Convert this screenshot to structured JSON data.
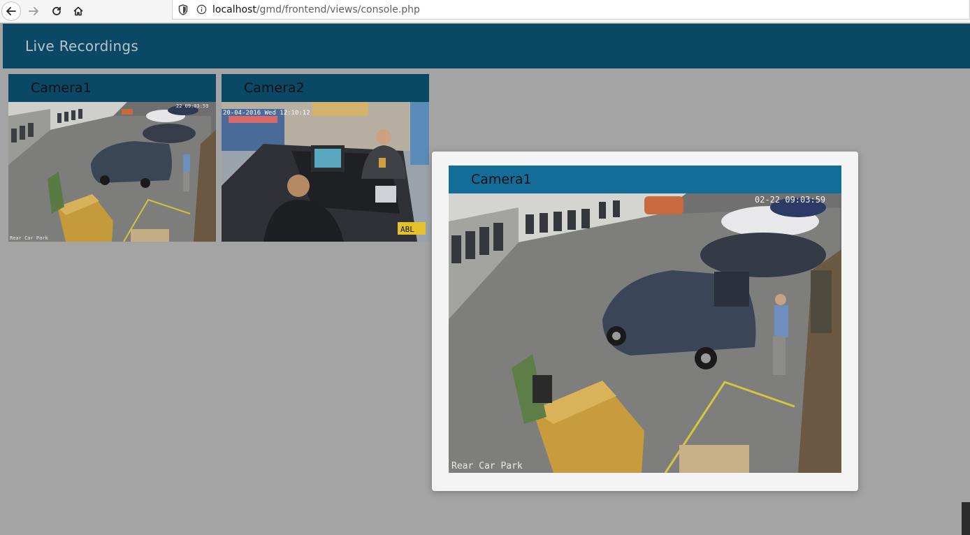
{
  "browser": {
    "url_host": "localhost",
    "url_path": "/gmd/frontend/views/console.php"
  },
  "header": {
    "title": "Live Recordings"
  },
  "cameras": [
    {
      "name": "Camera1",
      "overlay_label": "Rear Car Park",
      "timestamp": "22 09:03:59"
    },
    {
      "name": "Camera2",
      "overlay_date": "20-04-2016 Wed 12:10:12",
      "badge": "ABL"
    }
  ],
  "modal": {
    "camera_name": "Camera1",
    "overlay_label": "Rear Car Park",
    "timestamp": "02-22 09:03:59"
  },
  "icons": {
    "back": "arrow-left-icon",
    "forward": "arrow-right-icon",
    "reload": "reload-icon",
    "home": "home-icon",
    "shield": "shield-icon",
    "info": "info-icon"
  },
  "colors": {
    "header_bg": "#0a4866",
    "modal_head_bg": "#136d99",
    "page_bg": "#a4a4a4"
  }
}
